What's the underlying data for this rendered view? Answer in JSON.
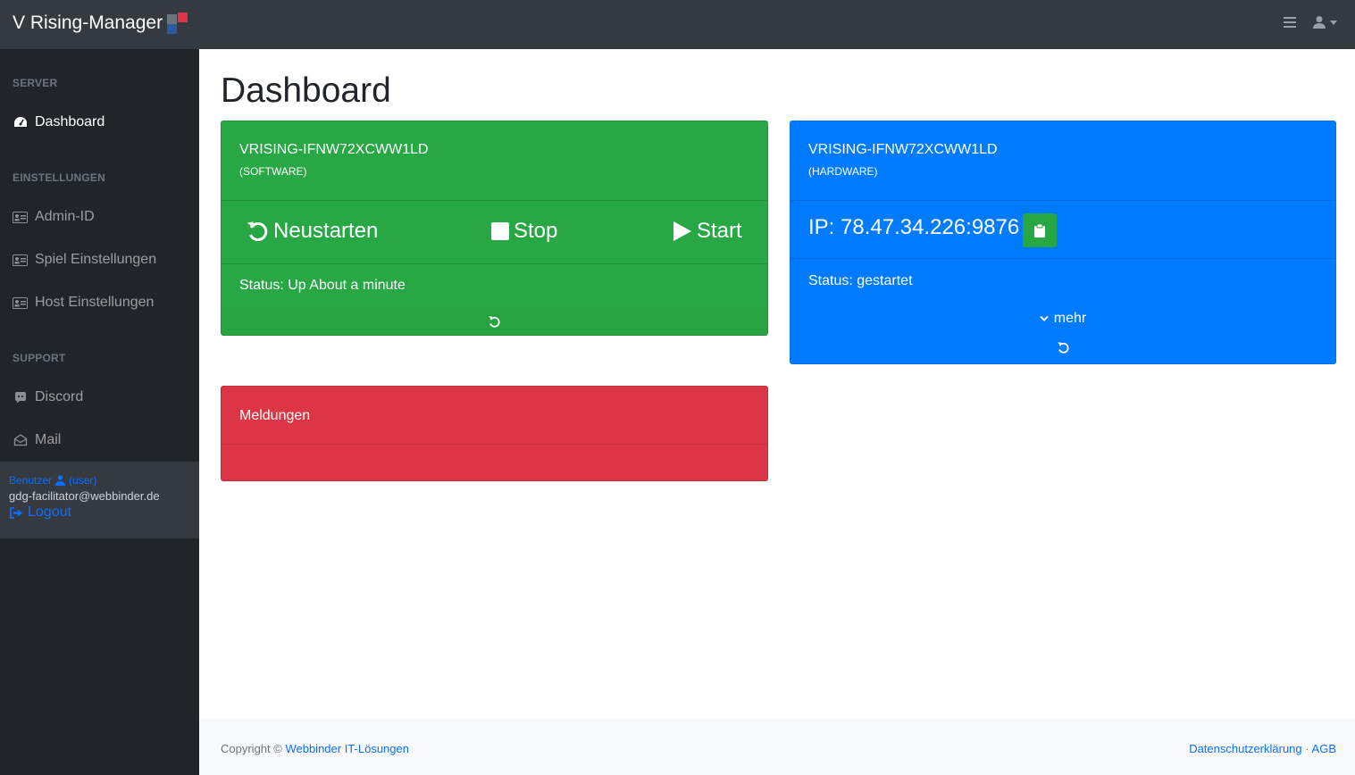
{
  "brand": {
    "title": "V Rising-Manager",
    "logo_colors": [
      "#6c757d",
      "#dc3545",
      "#2c5aa0"
    ]
  },
  "topnav": {
    "menu_icon": "hamburger-icon",
    "user_icon": "user-icon"
  },
  "sidebar": {
    "sections": [
      {
        "heading": "SERVER",
        "items": [
          {
            "label": "Dashboard",
            "icon": "gauge-icon",
            "active": true
          }
        ]
      },
      {
        "heading": "EINSTELLUNGEN",
        "items": [
          {
            "label": "Admin-ID",
            "icon": "id-card-icon"
          },
          {
            "label": "Spiel Einstellungen",
            "icon": "id-card-icon"
          },
          {
            "label": "Host Einstellungen",
            "icon": "id-card-icon"
          }
        ]
      },
      {
        "heading": "SUPPORT",
        "items": [
          {
            "label": "Discord",
            "icon": "discord-icon"
          },
          {
            "label": "Mail",
            "icon": "envelope-icon"
          }
        ]
      }
    ],
    "user": {
      "role_label": "Benutzer",
      "role_value": "(user)",
      "email": "gdg-facilitator@webbinder.de",
      "logout_label": "Logout"
    }
  },
  "main": {
    "title": "Dashboard",
    "software_card": {
      "server_name": "VRISING-IFNW72XCWW1LD",
      "subtitle": "(SOFTWARE)",
      "restart_label": "Neustarten",
      "stop_label": "Stop",
      "start_label": "Start",
      "status": "Status: Up About a minute",
      "color": "#28a745"
    },
    "hardware_card": {
      "server_name": "VRISING-IFNW72XCWW1LD",
      "subtitle": "(HARDWARE)",
      "ip": "IP: 78.47.34.226:9876",
      "status": "Status: gestartet",
      "more_label": "mehr",
      "color": "#007bff"
    },
    "messages_card": {
      "title": "Meldungen",
      "color": "#dc3545"
    }
  },
  "footer": {
    "copyright_prefix": "Copyright ©",
    "company": "Webbinder IT-Lösungen",
    "privacy": "Datenschutzerklärung",
    "separator": "·",
    "terms": "AGB"
  }
}
